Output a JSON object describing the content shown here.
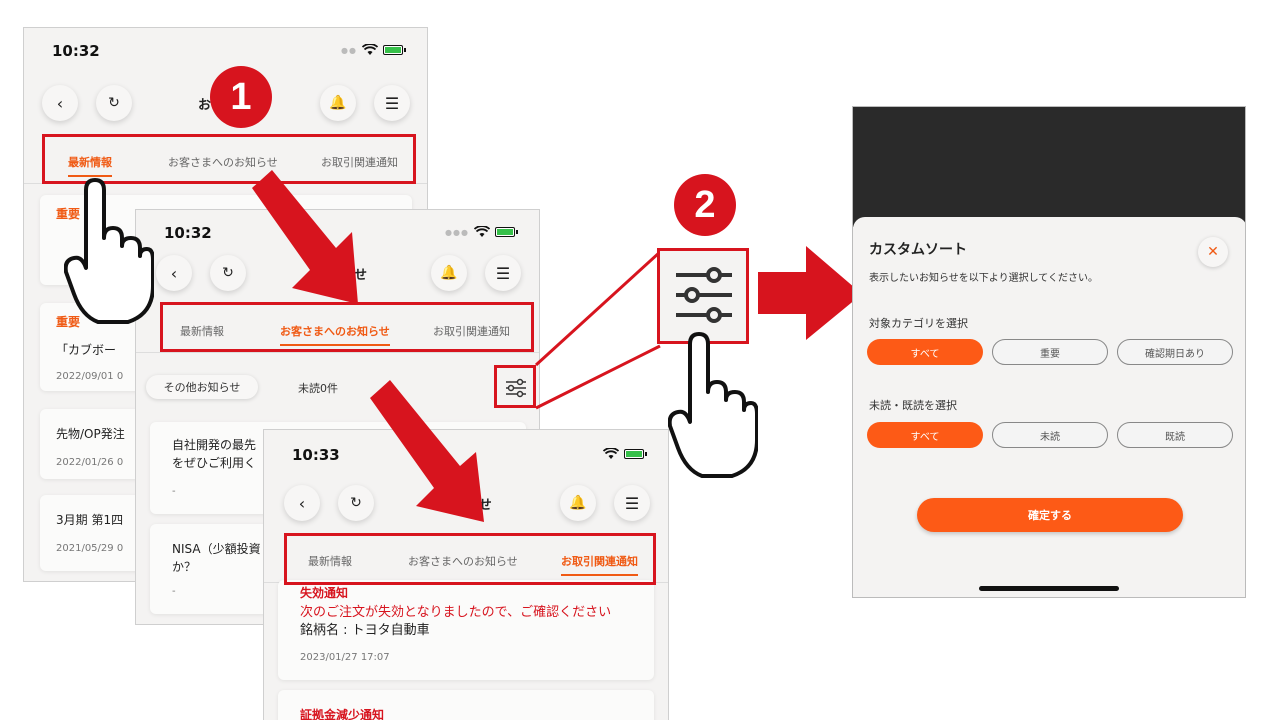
{
  "phone1": {
    "time": "10:32",
    "title_fragment": "お",
    "tabs": [
      "最新情報",
      "お客さまへのお知らせ",
      "お取引関連通知"
    ],
    "cards": [
      {
        "category": "重要",
        "title": "",
        "date": ""
      },
      {
        "category": "重要",
        "title": "「カブボー",
        "date": "2022/09/01 0"
      },
      {
        "category": "",
        "title": "先物/OP発注",
        "date": "2022/01/26 0"
      },
      {
        "category": "",
        "title": "3月期 第1四",
        "date": "2021/05/29 0"
      }
    ]
  },
  "phone2": {
    "time": "10:32",
    "title_fragment": "せ",
    "tabs": [
      "最新情報",
      "お客さまへのお知らせ",
      "お取引関連通知"
    ],
    "filter_chip": "その他お知らせ",
    "unread": "未読0件",
    "cards": [
      {
        "line1": "自社開発の最先",
        "line2": "をぜひご利用く",
        "date": "-"
      },
      {
        "line1": "NISA（少額投資",
        "line2": "か？",
        "date": "-"
      }
    ]
  },
  "phone3": {
    "time": "10:33",
    "title": "お知らせ",
    "tabs": [
      "最新情報",
      "お客さまへのお知らせ",
      "お取引関連通知"
    ],
    "cards": [
      {
        "category": "失効通知",
        "message": "次のご注文が失効となりましたので、ご確認ください",
        "detail": "銘柄名 : トヨタ自動車",
        "date": "2023/01/27 17:07"
      },
      {
        "category": "証拠金減少通知"
      }
    ]
  },
  "badges": {
    "one": "1",
    "two": "2"
  },
  "sheet": {
    "title": "カスタムソート",
    "description": "表示したいお知らせを以下より選択してください。",
    "section1_label": "対象カテゴリを選択",
    "section1_options": [
      "すべて",
      "重要",
      "確認期日あり"
    ],
    "section2_label": "未読・既読を選択",
    "section2_options": [
      "すべて",
      "未読",
      "既読"
    ],
    "confirm_label": "確定する"
  },
  "colors": {
    "accent": "#fd5a16",
    "highlight": "#d7141e"
  }
}
